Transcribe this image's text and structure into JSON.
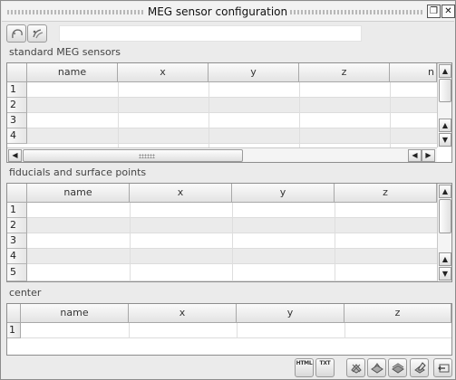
{
  "window": {
    "title": "MEG sensor configuration"
  },
  "toolbar": {
    "field_value": ""
  },
  "sections": {
    "sensors": {
      "label": "standard MEG sensors",
      "columns": [
        "name",
        "x",
        "y",
        "z",
        "n"
      ],
      "rows": [
        "1",
        "2",
        "3",
        "4"
      ]
    },
    "fiducials": {
      "label": "fiducials and surface points",
      "columns": [
        "name",
        "x",
        "y",
        "z"
      ],
      "rows": [
        "1",
        "2",
        "3",
        "4",
        "5"
      ]
    },
    "center": {
      "label": "center",
      "columns": [
        "name",
        "x",
        "y",
        "z"
      ],
      "rows": [
        "1"
      ]
    }
  },
  "bottom_buttons": {
    "html_label": "HTML",
    "txt_label": "TXT"
  },
  "colors": {
    "row_alt": "#ebebeb",
    "row_base": "#ffffff",
    "border": "#8e8e8e"
  }
}
